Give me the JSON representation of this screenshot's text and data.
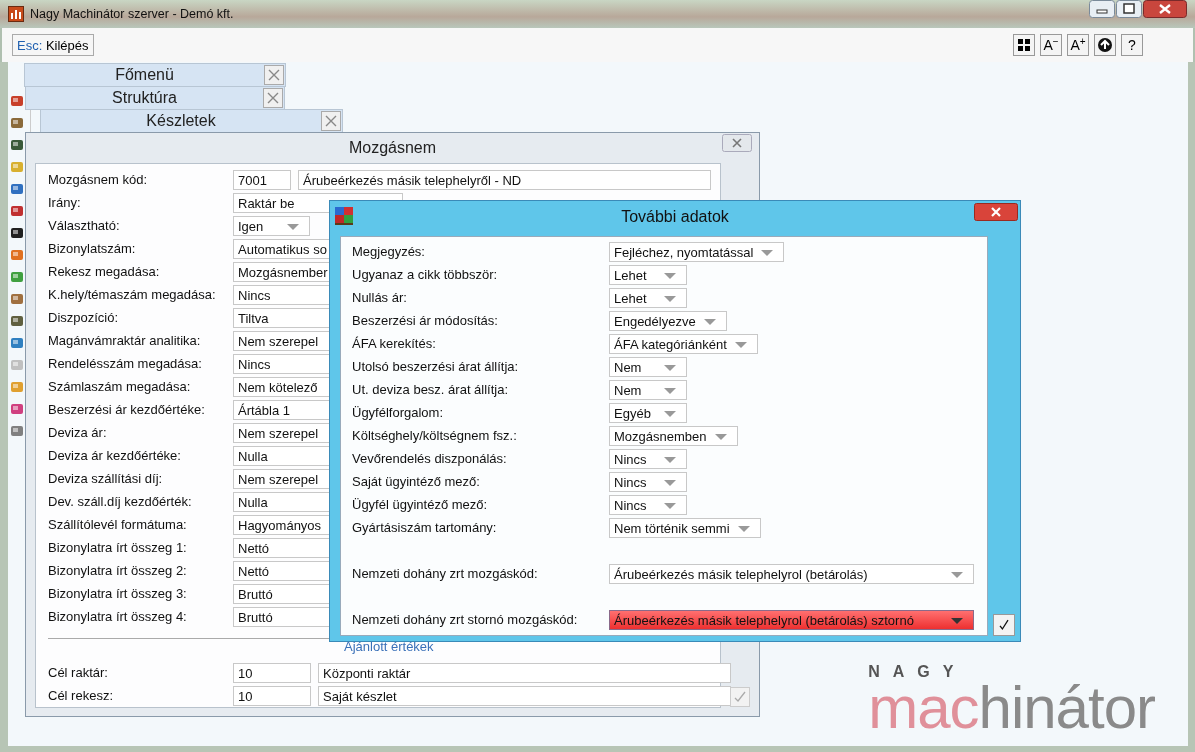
{
  "app": {
    "title": "Nagy Machinátor szerver - Demó kft."
  },
  "toolbar": {
    "exit": {
      "key": "Esc:",
      "label": "Kilépés"
    },
    "font_smaller": {
      "letter": "A",
      "sign": "−"
    },
    "font_larger": {
      "letter": "A",
      "sign": "+"
    },
    "help": "?"
  },
  "tabs": [
    {
      "label": "Főmenü"
    },
    {
      "label": "Struktúra"
    },
    {
      "label": "Készletek"
    }
  ],
  "mozgasnem": {
    "title": "Mozgásnem",
    "code_row": {
      "label": "Mozgásnem kód:",
      "code": "7001",
      "name": "Árubeérkezés másik telephelyről - ND"
    },
    "rows": [
      {
        "label": "Irány:",
        "value": "Raktár be",
        "kind": "field"
      },
      {
        "label": "Választható:",
        "value": "Igen",
        "kind": "dropdown"
      },
      {
        "label": "Bizonylatszám:",
        "value": "Automatikus so",
        "kind": "field"
      },
      {
        "label": "Rekesz megadása:",
        "value": "Mozgásnember",
        "kind": "field"
      },
      {
        "label": "K.hely/témaszám megadása:",
        "value": "Nincs",
        "kind": "field"
      },
      {
        "label": "Diszpozíció:",
        "value": "Tiltva",
        "kind": "field"
      },
      {
        "label": "Magánvámraktár analitika:",
        "value": "Nem szerepel",
        "kind": "field"
      },
      {
        "label": "Rendelésszám megadása:",
        "value": "Nincs",
        "kind": "field"
      },
      {
        "label": "Számlaszám megadása:",
        "value": "Nem kötelező",
        "kind": "field"
      },
      {
        "label": "Beszerzési ár kezdőértéke:",
        "value": "Ártábla 1",
        "kind": "field"
      },
      {
        "label": "Deviza ár:",
        "value": "Nem szerepel",
        "kind": "field"
      },
      {
        "label": "Deviza ár kezdőértéke:",
        "value": "Nulla",
        "kind": "field"
      },
      {
        "label": "Deviza szállítási díj:",
        "value": "Nem szerepel",
        "kind": "field"
      },
      {
        "label": "Dev. száll.díj kezdőérték:",
        "value": "Nulla",
        "kind": "field"
      },
      {
        "label": "Szállítólevél formátuma:",
        "value": "Hagyományos",
        "kind": "field"
      },
      {
        "label": "Bizonylatra írt összeg 1:",
        "value": "Nettó",
        "kind": "field"
      },
      {
        "label": "Bizonylatra írt összeg 2:",
        "value": "Nettó",
        "kind": "field"
      },
      {
        "label": "Bizonylatra írt összeg 3:",
        "value": "Bruttó",
        "kind": "field"
      },
      {
        "label": "Bizonylatra írt összeg 4:",
        "value": "Bruttó",
        "kind": "field"
      }
    ],
    "section": "Ajánlott értékek",
    "targets": [
      {
        "label": "Cél raktár:",
        "code": "10",
        "name": "Központi raktár"
      },
      {
        "label": "Cél rekesz:",
        "code": "10",
        "name": "Saját készlet"
      }
    ]
  },
  "dialog": {
    "title": "További adatok",
    "rows": [
      {
        "label": "Megjegyzés:",
        "value": "Fejléchez, nyomtatással",
        "kind": "dropdown",
        "invalid": false
      },
      {
        "label": "Ugyanaz a cikk többször:",
        "value": "Lehet",
        "kind": "dropdown",
        "invalid": false
      },
      {
        "label": "Nullás ár:",
        "value": "Lehet",
        "kind": "dropdown",
        "invalid": false
      },
      {
        "label": "Beszerzési ár módosítás:",
        "value": "Engedélyezve",
        "kind": "dropdown",
        "invalid": false
      },
      {
        "label": "ÁFA kerekítés:",
        "value": "ÁFA kategóriánként",
        "kind": "dropdown",
        "invalid": false
      },
      {
        "label": "Utolsó beszerzési árat állítja:",
        "value": "Nem",
        "kind": "dropdown",
        "invalid": false
      },
      {
        "label": "Ut. deviza besz. árat állítja:",
        "value": "Nem",
        "kind": "dropdown",
        "invalid": false
      },
      {
        "label": "Ügyfélforgalom:",
        "value": "Egyéb",
        "kind": "dropdown",
        "invalid": false
      },
      {
        "label": "Költséghely/költségnem fsz.:",
        "value": "Mozgásnemben",
        "kind": "dropdown",
        "invalid": false
      },
      {
        "label": "Vevőrendelés diszponálás:",
        "value": "Nincs",
        "kind": "dropdown",
        "invalid": false
      },
      {
        "label": "Saját ügyintéző mező:",
        "value": "Nincs",
        "kind": "dropdown",
        "invalid": false
      },
      {
        "label": "Ügyfél ügyintéző mező:",
        "value": "Nincs",
        "kind": "dropdown",
        "invalid": false
      },
      {
        "label": "Gyártásiszám tartomány:",
        "value": "Nem történik semmi",
        "kind": "dropdown",
        "invalid": false
      },
      {
        "label": "Nemzeti dohány zrt mozgáskód:",
        "value": "Árubeérkezés másik telephelyrol (betárolás)",
        "kind": "wide",
        "invalid": false
      },
      {
        "label": "Nemzeti dohány zrt stornó mozgáskód:",
        "value": "Árubeérkezés másik telephelyrol (betárolás) sztornó",
        "kind": "wide",
        "invalid": true
      }
    ]
  },
  "logo": {
    "top": "NAGY",
    "word": [
      "mac",
      "hinátor"
    ]
  }
}
